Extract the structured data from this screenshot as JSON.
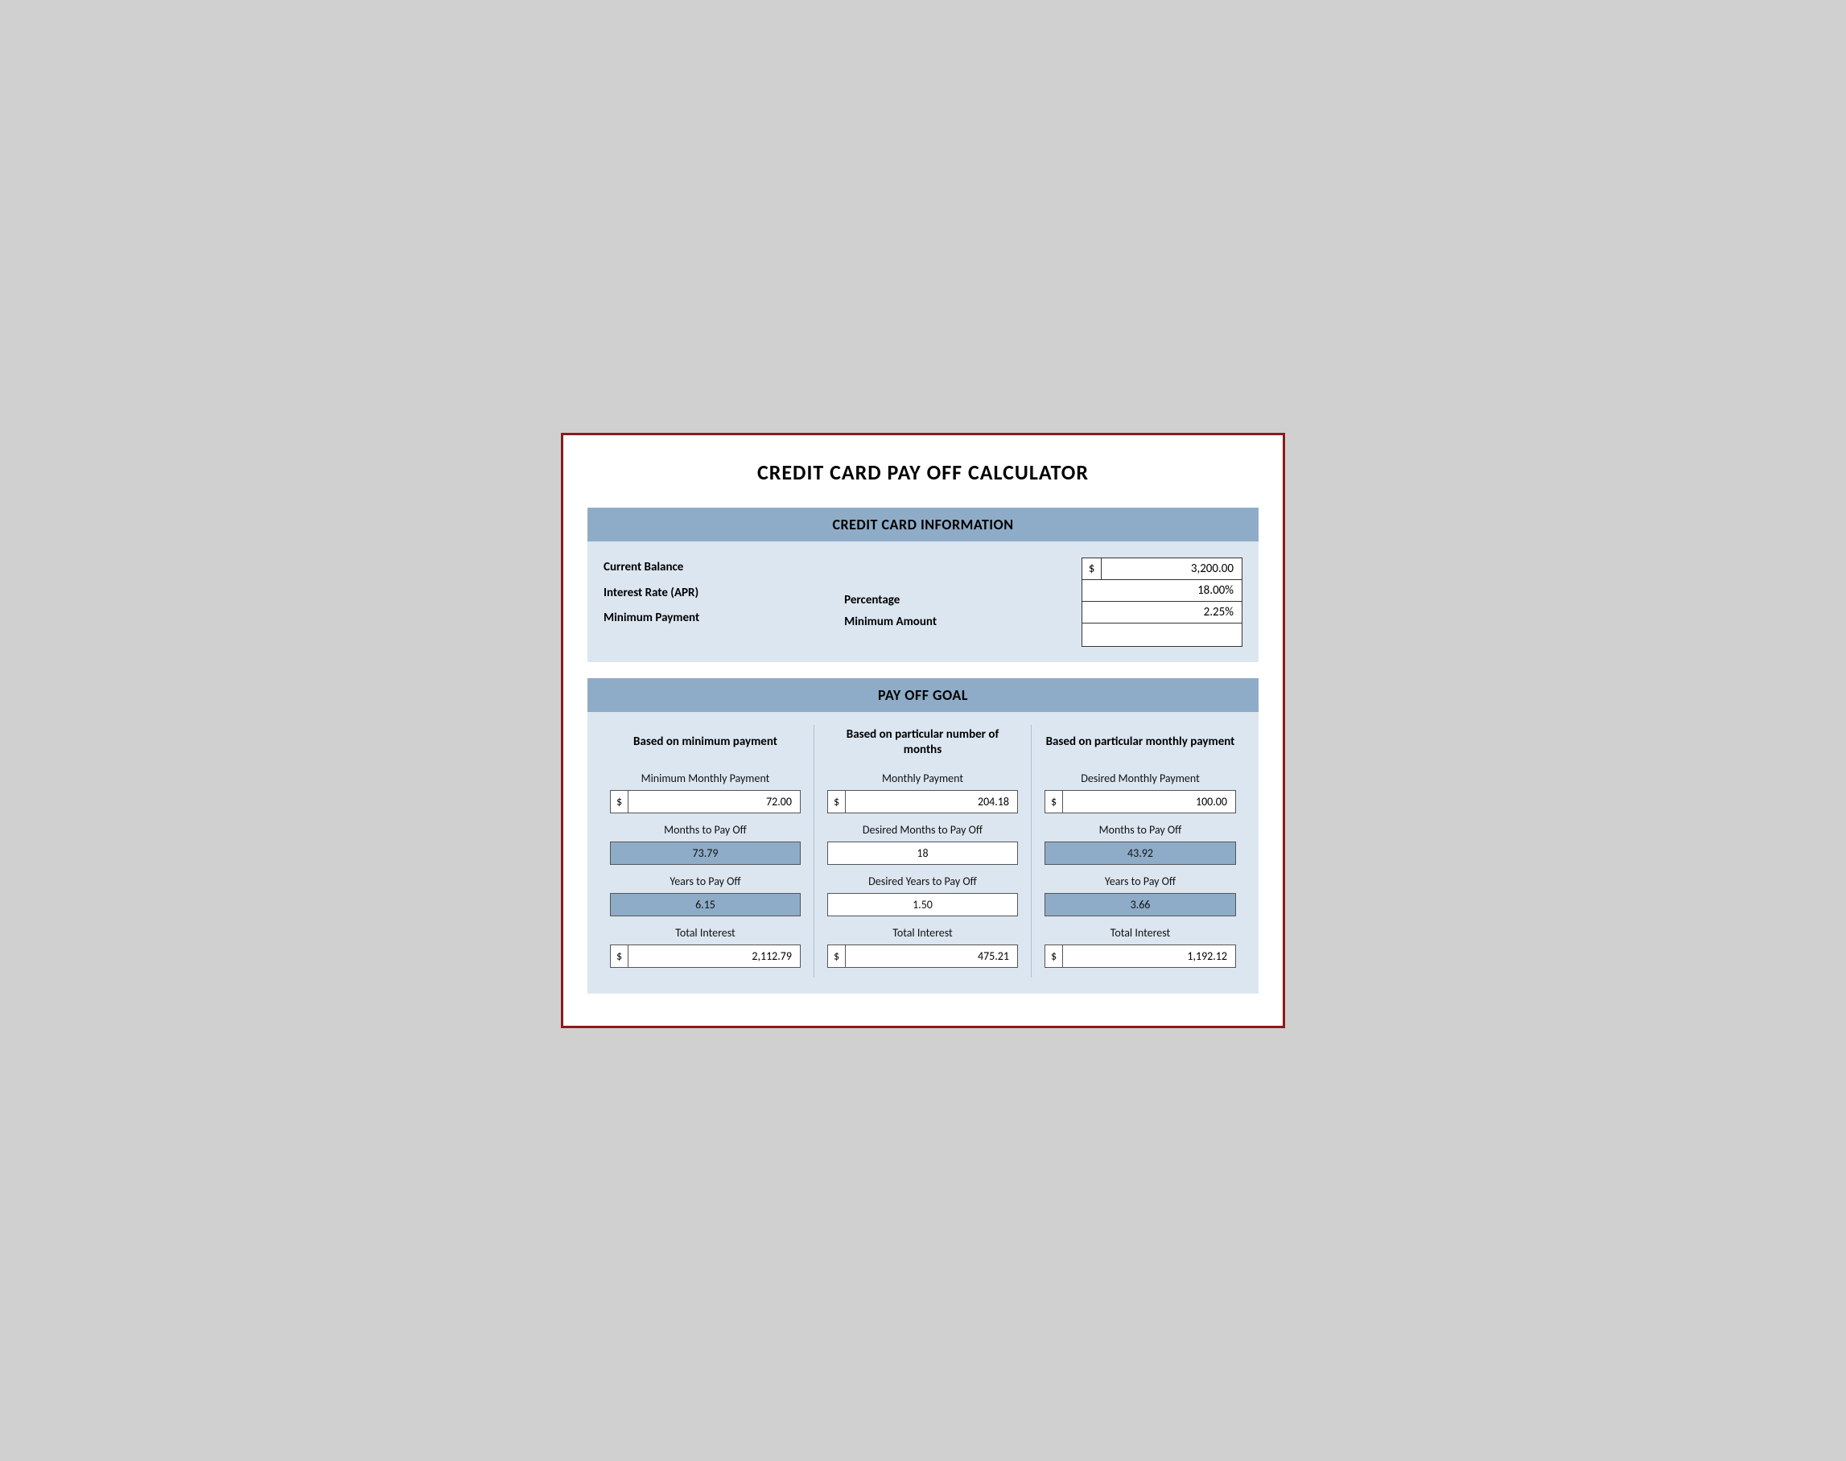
{
  "title": "CREDIT CARD PAY OFF CALCULATOR",
  "sections": {
    "credit_card_info": {
      "header": "CREDIT CARD INFORMATION",
      "labels": {
        "balance": "Current Balance",
        "interest": "Interest Rate (APR)",
        "minimum": "Minimum Payment",
        "percentage": "Percentage",
        "minimum_amount": "Minimum Amount"
      },
      "values": {
        "currency_symbol": "$",
        "balance": "3,200.00",
        "interest_rate": "18.00%",
        "min_payment_pct": "2.25%",
        "min_amount": ""
      }
    },
    "payoff_goal": {
      "header": "PAY OFF GOAL",
      "col1": {
        "header": "Based on minimum payment",
        "monthly_payment_label": "Minimum Monthly Payment",
        "monthly_payment_currency": "$",
        "monthly_payment_value": "72.00",
        "months_label": "Months to Pay Off",
        "months_value": "73.79",
        "years_label": "Years to Pay Off",
        "years_value": "6.15",
        "interest_label": "Total Interest",
        "interest_currency": "$",
        "interest_value": "2,112.79"
      },
      "col2": {
        "header": "Based on particular number of months",
        "monthly_payment_label": "Monthly Payment",
        "monthly_payment_currency": "$",
        "monthly_payment_value": "204.18",
        "months_label": "Desired Months to Pay Off",
        "months_value": "18",
        "years_label": "Desired Years to Pay Off",
        "years_value": "1.50",
        "interest_label": "Total Interest",
        "interest_currency": "$",
        "interest_value": "475.21"
      },
      "col3": {
        "header": "Based on particular monthly payment",
        "monthly_payment_label": "Desired Monthly Payment",
        "monthly_payment_currency": "$",
        "monthly_payment_value": "100.00",
        "months_label": "Months to Pay Off",
        "months_value": "43.92",
        "years_label": "Years to Pay Off",
        "years_value": "3.66",
        "interest_label": "Total Interest",
        "interest_currency": "$",
        "interest_value": "1,192.12"
      }
    }
  }
}
